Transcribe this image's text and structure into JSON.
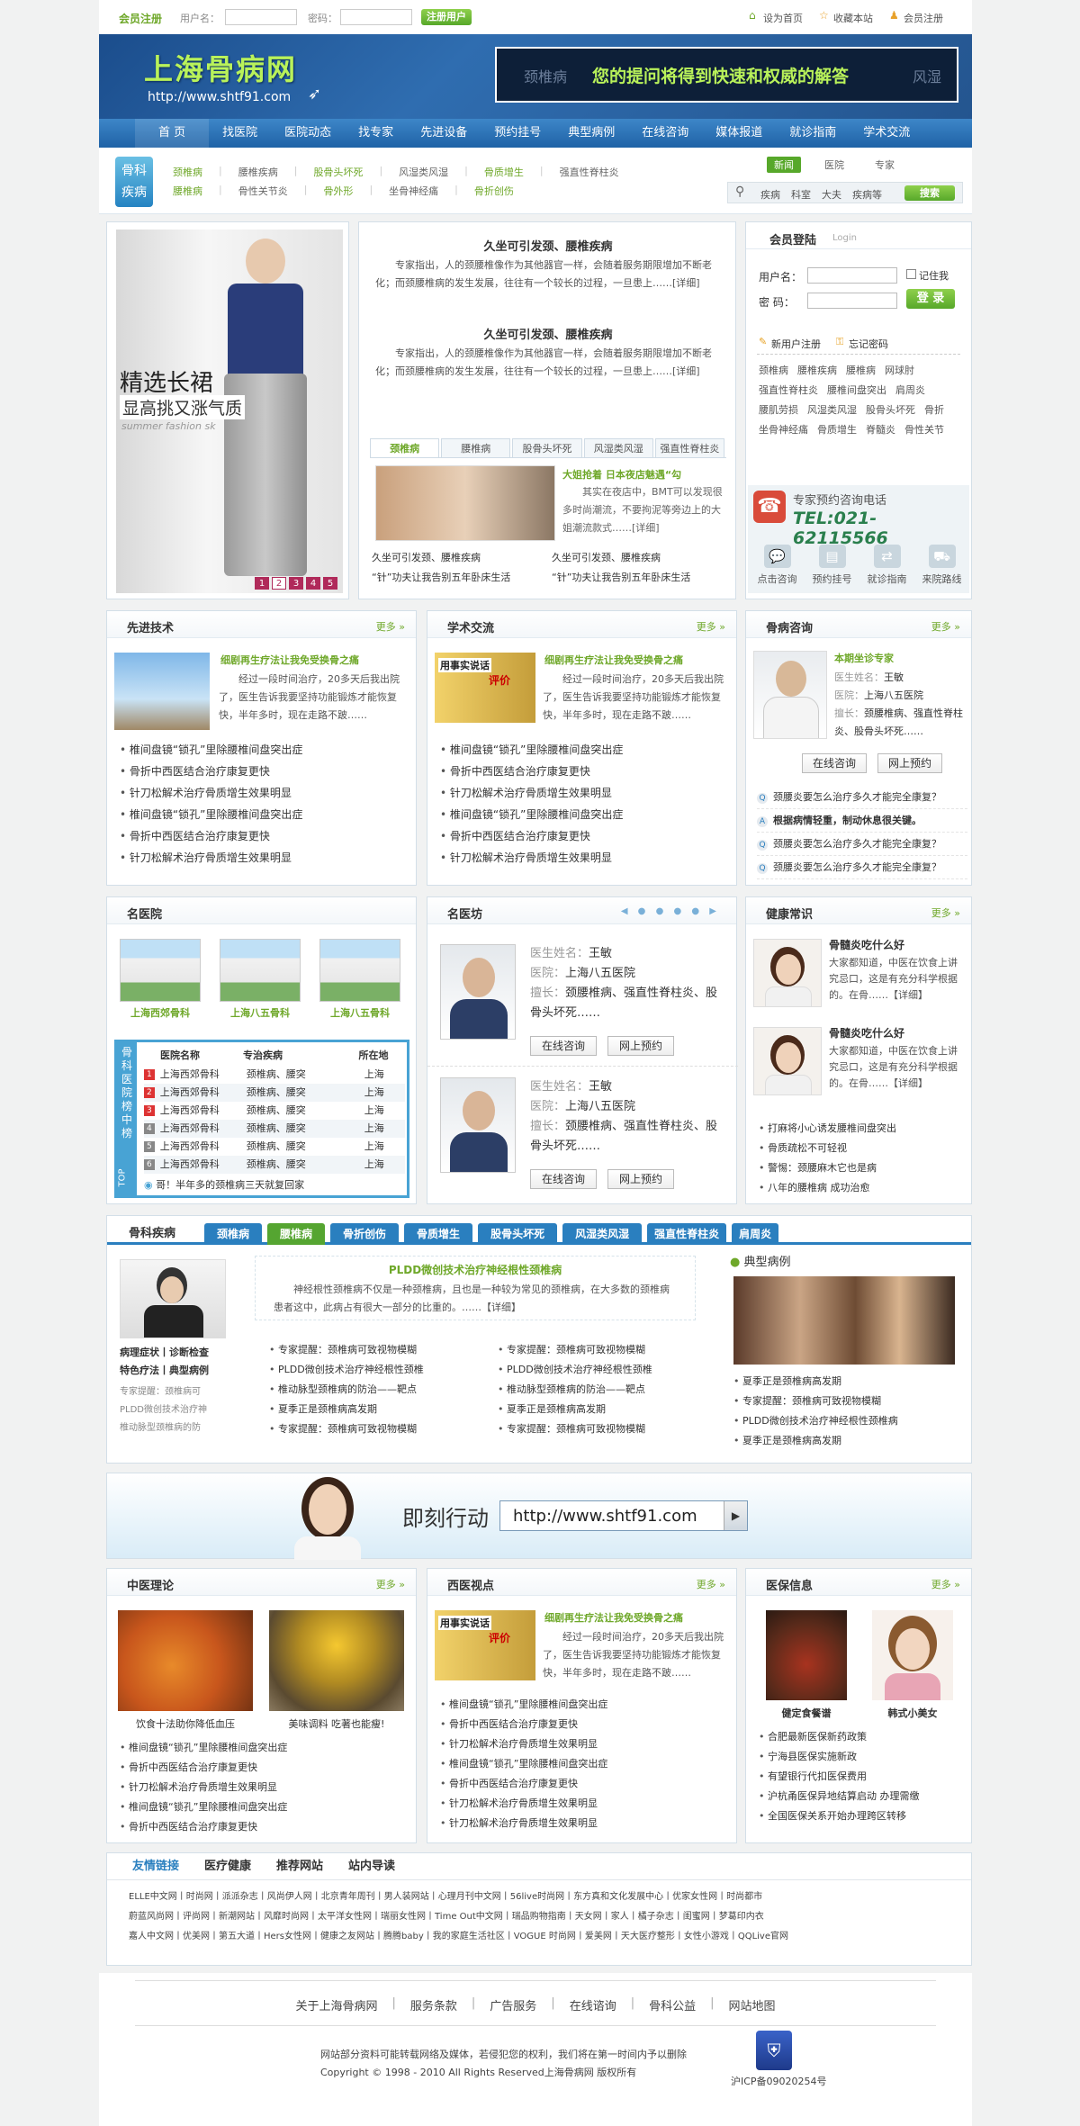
{
  "topbar": {
    "member_reg": "会员注册",
    "username_label": "用户名：",
    "password_label": "密码：",
    "reg_btn": "注册用户",
    "set_home": "设为首页",
    "bookmark": "收藏本站",
    "member_reg2": "会员注册"
  },
  "header": {
    "logo": "上海骨病网",
    "url": "http://www.shtf91.com",
    "banner_left": "颈椎病",
    "banner_text": "您的提问将得到快速和权威的解答",
    "banner_right": "风湿"
  },
  "nav": [
    "首 页",
    "找医院",
    "医院动态",
    "找专家",
    "先进设备",
    "预约挂号",
    "典型病例",
    "在线咨询",
    "媒体报道",
    "就诊指南",
    "学术交流"
  ],
  "subnav": {
    "badge1": "骨科",
    "badge2": "疾病",
    "row1": [
      "颈椎病",
      "腰椎疾病",
      "股骨头坏死",
      "风湿类风湿",
      "骨质增生",
      "强直性脊柱炎"
    ],
    "row2": [
      "腰椎病",
      "骨性关节炎",
      "骨外形",
      "坐骨神经痛",
      "骨折创伤"
    ],
    "tabs": [
      "新闻",
      "医院",
      "专家"
    ],
    "search_items": [
      "疾病",
      "科室",
      "大夫",
      "疾病等"
    ],
    "search_btn": "搜索"
  },
  "promo": {
    "title": "精选长裙",
    "subtitle": "显高挑又涨气质",
    "en": "summer fashion sk",
    "pages": [
      "1",
      "2",
      "3",
      "4",
      "5"
    ]
  },
  "news": {
    "a_title": "久坐可引发颈、腰椎疾病",
    "a_text": "专家指出，人的颈腰椎像作为其他器官一样，会随着服务期限增加不断老化；而颈腰椎病的发生发展，往往有一个较长的过程，一旦患上……[详细]",
    "b_title": "久坐可引发颈、腰椎疾病",
    "b_text": "专家指出，人的颈腰椎像作为其他器官一样，会随着服务期限增加不断老化；而颈腰椎病的发生发展，往往有一个较长的过程，一旦患上……[详细]",
    "tabs": [
      "颈椎病",
      "腰椎病",
      "股骨头坏死",
      "风湿类风湿",
      "强直性脊柱炎"
    ],
    "feat_title": "大姐抢着 日本夜店魅遇“勾",
    "feat_text": "其实在夜店中，BMT可以发现很多时尚潮流，不要拘泥等旁边上的大姐潮流款式……[详细]",
    "links": [
      "久坐可引发颈、腰椎疾病",
      "“针”功夫让我告别五年卧床生活",
      "久坐可引发颈、腰椎疾病",
      "“针”功夫让我告别五年卧床生活"
    ]
  },
  "login": {
    "title": "会员登陆",
    "title_en": "Login",
    "user": "用户名：",
    "pwd": "密 码：",
    "remember": "记住我",
    "btn": "登 录",
    "reg": "新用户注册",
    "forgot": "忘记密码",
    "tags": [
      "颈椎病",
      "腰椎疾病",
      "腰椎病",
      "网球肘",
      "强直性脊柱炎",
      "腰椎间盘突出",
      "肩周炎",
      "腰肌劳损",
      "风湿类风湿",
      "股骨头坏死",
      "骨折",
      "坐骨神经痛",
      "骨质增生",
      "脊髓炎",
      "骨性关节"
    ],
    "hotline_label": "专家预约咨询电话",
    "hotline": "TEL:021-62115566",
    "icons": [
      "点击咨询",
      "预约挂号",
      "就诊指南",
      "来院路线"
    ]
  },
  "adv": {
    "title": "先进技术",
    "more": "更多",
    "art_title": "细剧再生疗法让我免受换骨之痛",
    "art_text": "经过一段时间治疗，20多天后我出院了，医生告诉我要坚持功能锻炼才能恢复快，半年多时，现在走路不跛……",
    "list": [
      "椎间盘镜“锁孔”里除腰椎间盘突出症",
      "骨折中西医结合治疗康复更快",
      "针刀松解术治疗骨质增生效果明显",
      "椎间盘镜“锁孔”里除腰椎间盘突出症",
      "骨折中西医结合治疗康复更快",
      "针刀松解术治疗骨质增生效果明显"
    ]
  },
  "acad": {
    "title": "学术交流",
    "more": "更多",
    "art_title": "细剧再生疗法让我免受换骨之痛",
    "art_text": "经过一段时间治疗，20多天后我出院了，医生告诉我要坚持功能锻炼才能恢复快，半年多时，现在走路不跛……",
    "img_a": "用事实说话",
    "img_b": "评价",
    "list": [
      "椎间盘镜“锁孔”里除腰椎间盘突出症",
      "骨折中西医结合治疗康复更快",
      "针刀松解术治疗骨质增生效果明显",
      "椎间盘镜“锁孔”里除腰椎间盘突出症",
      "骨折中西医结合治疗康复更快",
      "针刀松解术治疗骨质增生效果明显"
    ]
  },
  "consult": {
    "title": "骨病咨询",
    "more": "更多",
    "star": "本期坐诊专家",
    "name_l": "医生姓名：",
    "name": "王敏",
    "hosp_l": "医院：",
    "hosp": "上海八五医院",
    "spec_l": "擅长：",
    "spec": "颈腰椎病、强直性脊柱炎、股骨头坏死……",
    "btn1": "在线咨询",
    "btn2": "网上预约",
    "qa": [
      "颈腰炎要怎么治疗多久才能完全康复？",
      "根据病情轻重，制动休息很关键。",
      "颈腰炎要怎么治疗多久才能完全康复？",
      "颈腰炎要怎么治疗多久才能完全康复？"
    ]
  },
  "hospitals": {
    "title": "名医院",
    "items": [
      "上海西郊骨科",
      "上海八五骨科",
      "上海八五骨科"
    ],
    "rank_side": "骨科医院榜中榜",
    "rank_top": "TOP",
    "headers": [
      "医院名称",
      "专治疾病",
      "所在地"
    ],
    "rows": [
      [
        "上海西郊骨科",
        "颈椎病、腰突",
        "上海"
      ],
      [
        "上海西郊骨科",
        "颈椎病、腰突",
        "上海"
      ],
      [
        "上海西郊骨科",
        "颈椎病、腰突",
        "上海"
      ],
      [
        "上海西郊骨科",
        "颈椎病、腰突",
        "上海"
      ],
      [
        "上海西郊骨科",
        "颈椎病、腰突",
        "上海"
      ],
      [
        "上海西郊骨科",
        "颈椎病、腰突",
        "上海"
      ]
    ],
    "note": "哥！半年多的颈椎病三天就复回家"
  },
  "doctors": {
    "title": "名医坊",
    "items": [
      {
        "name_l": "医生姓名：",
        "name": "王敏",
        "hosp_l": "医院：",
        "hosp": "上海八五医院",
        "spec_l": "擅长：",
        "spec": "颈腰椎病、强直性脊柱炎、股骨头坏死……",
        "b1": "在线咨询",
        "b2": "网上预约"
      },
      {
        "name_l": "医生姓名：",
        "name": "王敏",
        "hosp_l": "医院：",
        "hosp": "上海八五医院",
        "spec_l": "擅长：",
        "spec": "颈腰椎病、强直性脊柱炎、股骨头坏死……",
        "b1": "在线咨询",
        "b2": "网上预约"
      }
    ]
  },
  "health": {
    "title": "健康常识",
    "more": "更多",
    "items": [
      {
        "t": "骨髓炎吃什么好",
        "d": "大家都知道，中医在饮食上讲究忌口，这是有充分科学根据的。在骨……【详细】"
      },
      {
        "t": "骨髓炎吃什么好",
        "d": "大家都知道，中医在饮食上讲究忌口，这是有充分科学根据的。在骨……【详细】"
      }
    ],
    "list": [
      "打麻将小心诱发腰椎间盘突出",
      "骨质疏松不可轻视",
      "警惕：颈腰麻木它也是病",
      "八年的腰椎病 成功治愈"
    ]
  },
  "disease": {
    "title": "骨科疾病",
    "tabs": [
      "颈椎病",
      "腰椎病",
      "骨折创伤",
      "骨质增生",
      "股骨头坏死",
      "风湿类风湿",
      "强直性脊柱炎",
      "肩周炎"
    ],
    "side_caption": "病理症状丨诊断检查\n特色疗法丨典型病例",
    "side_list": [
      "专家提醒：颈椎病可",
      "PLDD微创技术治疗神",
      "椎动脉型颈椎病的防"
    ],
    "art_title": "PLDD微创技术治疗神经根性颈椎病",
    "art_text": "神经根性颈椎病不仅是一种颈椎病，且也是一种较为常见的颈椎病，在大多数的颈椎病患者这中，此病占有很大一部分的比重的。……【详细】",
    "col1": [
      "专家提醒：颈椎病可致视物模糊",
      "PLDD微创技术治疗神经根性颈椎",
      "椎动脉型颈椎病的防治——靶点",
      "夏季正是颈椎病高发期",
      "专家提醒：颈椎病可致视物模糊"
    ],
    "col2": [
      "专家提醒：颈椎病可致视物模糊",
      "PLDD微创技术治疗神经根性颈椎",
      "椎动脉型颈椎病的防治——靶点",
      "夏季正是颈椎病高发期",
      "专家提醒：颈椎病可致视物模糊"
    ],
    "case_title": "典型病例",
    "case_list": [
      "夏季正是颈椎病高发期",
      "专家提醒：颈椎病可致视物模糊",
      "PLDD微创技术治疗神经根性颈椎病",
      "夏季正是颈椎病高发期"
    ]
  },
  "action": {
    "label": "即刻行动",
    "url": "http://www.shtf91.com"
  },
  "tcm": {
    "title": "中医理论",
    "more": "更多",
    "captions": [
      "饮食十法助你降低血压",
      "美味调料 吃著也能瘦!"
    ],
    "list": [
      "椎间盘镜“锁孔”里除腰椎间盘突出症",
      "骨折中西医结合治疗康复更快",
      "针刀松解术治疗骨质增生效果明显",
      "椎间盘镜“锁孔”里除腰椎间盘突出症",
      "骨折中西医结合治疗康复更快"
    ]
  },
  "western": {
    "title": "西医视点",
    "more": "更多",
    "art_title": "细剧再生疗法让我免受换骨之痛",
    "art_text": "经过一段时间治疗，20多天后我出院了，医生告诉我要坚持功能锻炼才能恢复快，半年多时，现在走路不跛……",
    "img_a": "用事实说话",
    "img_b": "评价",
    "list": [
      "椎间盘镜“锁孔”里除腰椎间盘突出症",
      "骨折中西医结合治疗康复更快",
      "针刀松解术治疗骨质增生效果明显",
      "椎间盘镜“锁孔”里除腰椎间盘突出症",
      "骨折中西医结合治疗康复更快",
      "针刀松解术治疗骨质增生效果明显",
      "针刀松解术治疗骨质增生效果明显"
    ]
  },
  "medinfo": {
    "title": "医保信息",
    "more": "更多",
    "captions": [
      "健定食餐谱",
      "韩式小美女"
    ],
    "list": [
      "合肥最新医保新药政策",
      "宁海县医保实施新政",
      "有望银行代扣医保费用",
      "沪杭甬医保异地结算启动 办理需缴",
      "全国医保关系开始办理跨区转移"
    ]
  },
  "links": {
    "tabs": [
      "友情链接",
      "医疗健康",
      "推荐网站",
      "站内导读"
    ],
    "rows": [
      "ELLE中文网丨时尚网丨派派杂志丨风尚伊人网丨北京青年周刊丨男人装网站丨心理月刊中文网丨56live时尚网丨东方真和文化发展中心丨优家女性网丨时尚都市",
      "蔚蓝风尚网丨评尚网丨新潮网站丨风靡时尚网丨太平洋女性网丨瑞丽女性网丨Time Out中文网丨瑞品购物指南丨天女网丨家人丨橘子杂志丨闺蜜网丨梦葛印内衣",
      "嘉人中文网丨优美网丨第五大道丨Hers女性网丨健康之友网站丨腾腾baby丨我的家庭生活社区丨VOGUE 时尚网丨爱美网丨天大医疗整形丨女性小游戏丨QQLive官网"
    ]
  },
  "footer": {
    "links": [
      "关于上海骨病网",
      "服务条款",
      "广告服务",
      "在线谘询",
      "骨科公益",
      "网站地图"
    ],
    "notice": "网站部分资料可能转载网络及媒体，若侵犯您的权利，我们将在第一时间内予以删除",
    "copyright": "Copyright © 1998 - 2010  All Rights Reserved上海骨病网 版权所有",
    "icp": "沪ICP备09020254号"
  }
}
